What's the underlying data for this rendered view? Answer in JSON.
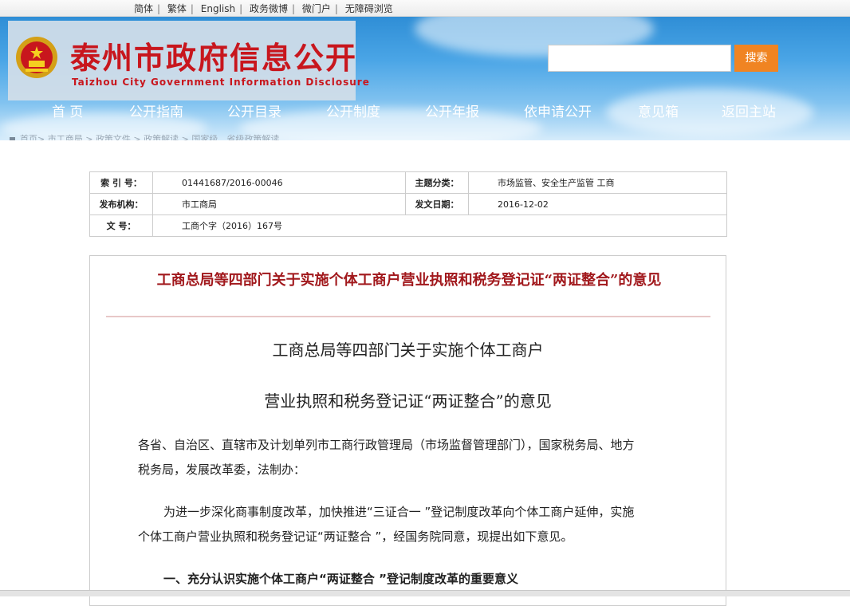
{
  "top_links": [
    "简体",
    "繁体",
    "English",
    "政务微博",
    "微门户",
    "无障碍浏览"
  ],
  "site": {
    "title": "泰州市政府信息公开",
    "subtitle": "Taizhou City Government Information Disclosure"
  },
  "search": {
    "button": "搜索",
    "value": ""
  },
  "nav": [
    "首 页",
    "公开指南",
    "公开目录",
    "公开制度",
    "公开年报",
    "依申请公开",
    "意见箱",
    "返回主站"
  ],
  "breadcrumb": [
    "首页",
    "市工商局",
    "政策文件",
    "政策解读",
    "国家级、省级政策解读"
  ],
  "info": {
    "index_label": "索 引 号：",
    "index_value": "01441687/2016-00046",
    "topic_label": "主题分类：",
    "topic_value": "市场监管、安全生产监管 工商",
    "publisher_label": "发布机构：",
    "publisher_value": "市工商局",
    "date_label": "发文日期：",
    "date_value": "2016-12-02",
    "docno_label": "文 号：",
    "docno_value": "工商个字（2016）167号"
  },
  "article": {
    "red_title": "工商总局等四部门关于实施个体工商户营业执照和税务登记证“两证整合”的意见",
    "heading_line1": "工商总局等四部门关于实施个体工商户",
    "heading_line2": "营业执照和税务登记证“两证整合”的意见",
    "para1_line1": "各省、自治区、直辖市及计划单列市工商行政管理局（市场监督管理部门），国家税务局、地方",
    "para1_line2": "税务局，发展改革委，法制办：",
    "para2_line1": "为进一步深化商事制度改革，加快推进“三证合一 ”登记制度改革向个体工商户延伸，实施",
    "para2_line2": "个体工商户营业执照和税务登记证“两证整合 ”，经国务院同意，现提出如下意见。",
    "section1": "一、充分认识实施个体工商户“两证整合 ”登记制度改革的重要意义"
  },
  "colors": {
    "brand_red": "#c8161d",
    "title_red": "#a1181c",
    "search_orange": "#f08422",
    "sky_blue": "#4aa5e6"
  }
}
